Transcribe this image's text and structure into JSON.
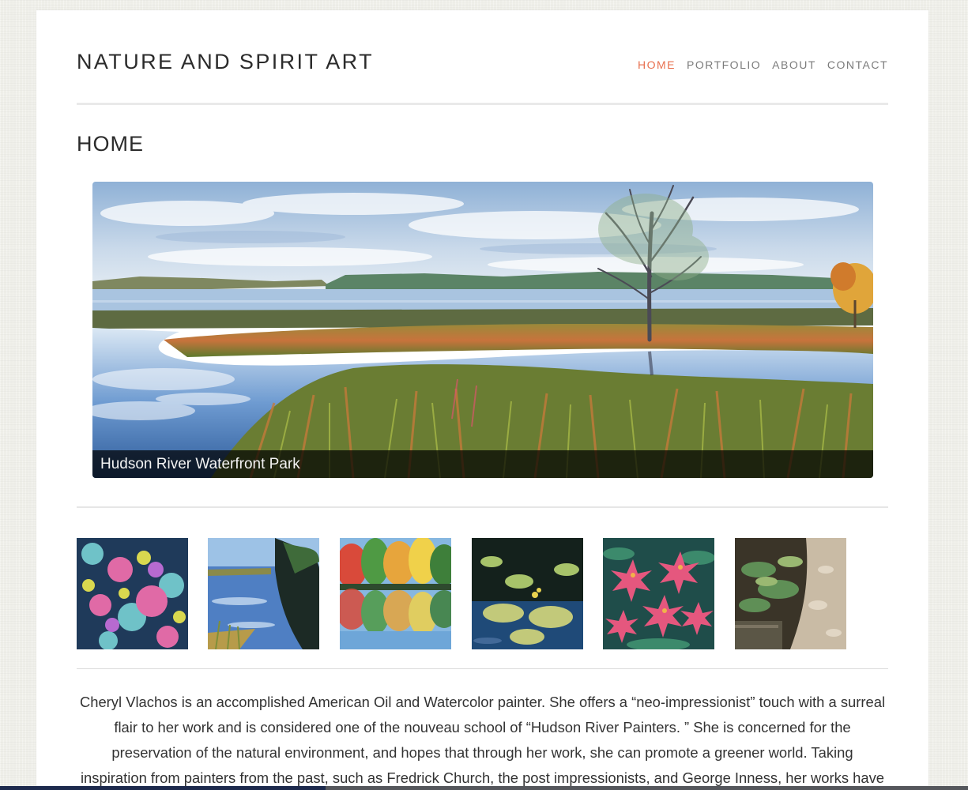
{
  "site": {
    "title": "NATURE AND SPIRIT ART"
  },
  "nav": {
    "items": [
      "HOME",
      "PORTFOLIO",
      "ABOUT",
      "CONTACT"
    ],
    "active": "HOME"
  },
  "page": {
    "heading": "HOME"
  },
  "slider": {
    "caption": "Hudson River Waterfront Park"
  },
  "thumbnails": [
    {
      "subject": "pink-blue-foliage-painting"
    },
    {
      "subject": "river-trees-reflection-painting"
    },
    {
      "subject": "autumn-trees-lake-painting"
    },
    {
      "subject": "lily-pads-painting"
    },
    {
      "subject": "pink-lilies-painting"
    },
    {
      "subject": "forest-path-plants-painting"
    }
  ],
  "bio": {
    "text": "Cheryl Vlachos is an accomplished American Oil and Watercolor painter. She offers a “neo-impressionist” touch with a surreal flair to her work and is considered one of the nouveau school of “Hudson River Painters. ” She is concerned for the preservation of the natural environment, and hopes that through her work, she can promote a greener world. Taking inspiration from painters from the past, such as Fredrick Church, the post impressionists, and George Inness, her works have been seen in many New York"
  },
  "colors": {
    "accent": "#e8704f",
    "nav_text": "#7b7b7b",
    "title_text": "#2b2b2b",
    "body_text": "#333333",
    "background": "#efefe9"
  }
}
